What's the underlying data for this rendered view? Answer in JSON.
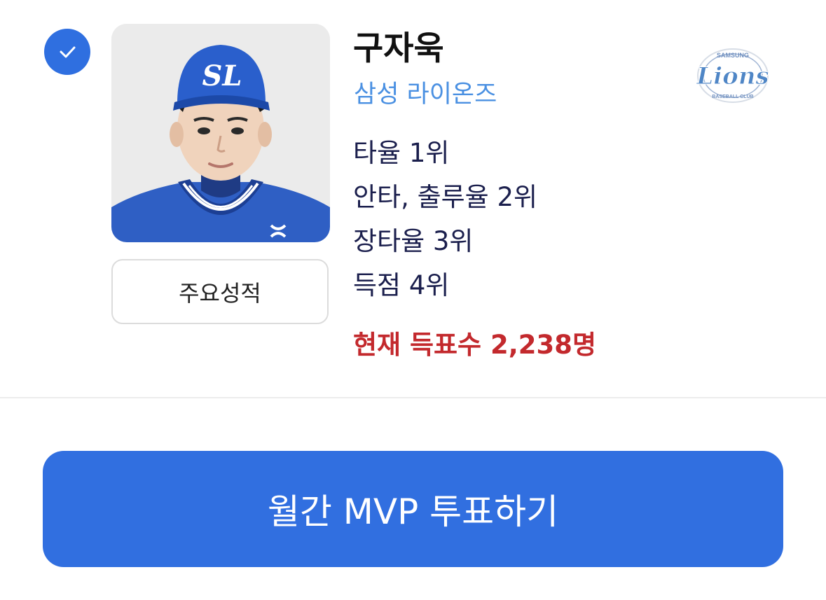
{
  "player": {
    "selected": true,
    "name": "구자욱",
    "team": "삼성 라이온즈",
    "stats_button_label": "주요성적",
    "records": [
      "타율 1위",
      "안타, 출루율 2위",
      "장타율 3위",
      "득점 4위"
    ],
    "votes_text": "현재 득표수 2,238명",
    "cap_logo": "SL",
    "team_logo": {
      "top_text": "SAMSUNG",
      "wordmark": "Lions",
      "bottom_text": "BASEBALL CLUB"
    }
  },
  "actions": {
    "vote_button_label": "월간 MVP 투표하기"
  },
  "colors": {
    "accent_blue": "#316fe0",
    "team_blue": "#4a90e2",
    "record_text": "#1b1f4d",
    "votes_red": "#c3292d"
  },
  "icons": {
    "check": "check-icon"
  }
}
